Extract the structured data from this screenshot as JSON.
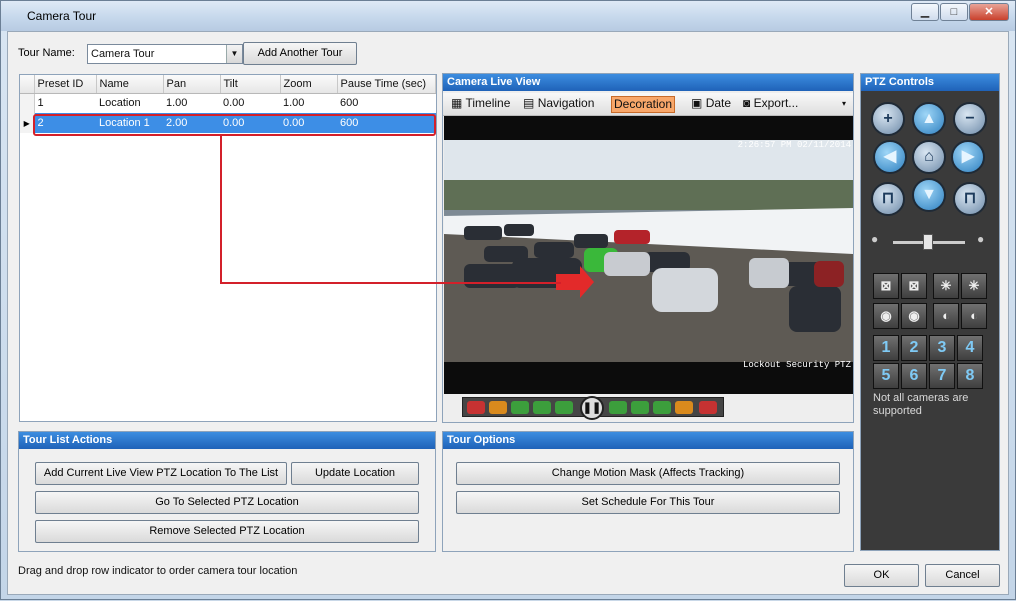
{
  "window": {
    "title": "Camera Tour",
    "minimize": "▁",
    "maximize": "□",
    "close": "✕"
  },
  "tour": {
    "name_label": "Tour Name:",
    "name_value": "Camera Tour",
    "add_another": "Add Another Tour"
  },
  "table": {
    "headers": [
      "Preset ID",
      "Name",
      "Pan",
      "Tilt",
      "Zoom",
      "Pause Time (sec)"
    ],
    "rows": [
      {
        "id": "1",
        "name": "Location",
        "pan": "1.00",
        "tilt": "0.00",
        "zoom": "1.00",
        "pause": "600"
      },
      {
        "id": "2",
        "name": "Location 1",
        "pan": "2.00",
        "tilt": "0.00",
        "zoom": "0.00",
        "pause": "600"
      }
    ]
  },
  "live_view": {
    "title": "Camera Live View",
    "toolbar": {
      "timeline": "Timeline",
      "navigation": "Navigation",
      "decoration": "Decoration",
      "date": "Date",
      "export": "Export..."
    },
    "overlay_top": "2:26:57 PM 02/11/2014",
    "overlay_bottom": "Lockout Security PTZ"
  },
  "ptz": {
    "title": "PTZ Controls",
    "note": "Not all cameras are supported",
    "presets": [
      "1",
      "2",
      "3",
      "4",
      "5",
      "6",
      "7",
      "8"
    ]
  },
  "tour_list_actions": {
    "title": "Tour List Actions",
    "add_current": "Add Current Live View PTZ Location To The List",
    "update": "Update Location",
    "goto": "Go To Selected PTZ Location",
    "remove": "Remove Selected PTZ Location"
  },
  "tour_options": {
    "title": "Tour Options",
    "motion_mask": "Change Motion Mask (Affects Tracking)",
    "schedule": "Set Schedule For This Tour"
  },
  "footer": {
    "hint": "Drag and drop row indicator to order camera tour location",
    "ok": "OK",
    "cancel": "Cancel"
  },
  "colors": {
    "accent": "#2f7fd6",
    "selection": "#3d8ee6",
    "annotation": "#d3202a"
  }
}
